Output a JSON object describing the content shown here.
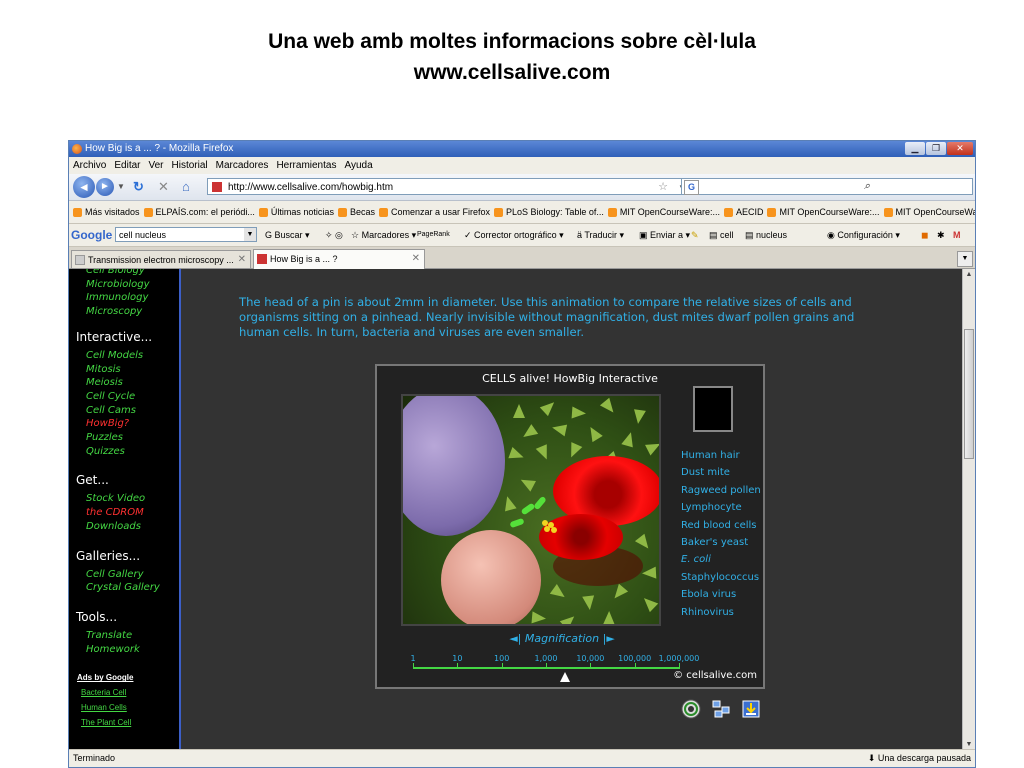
{
  "slide": {
    "title_line1": "Una web amb moltes informacions sobre cèl·lula",
    "title_line2": "www.cellsalive.com"
  },
  "browser": {
    "window_title": "How Big is a ... ? - Mozilla Firefox",
    "menu": [
      "Archivo",
      "Editar",
      "Ver",
      "Historial",
      "Marcadores",
      "Herramientas",
      "Ayuda"
    ],
    "url": "http://www.cellsalive.com/howbig.htm",
    "search_engine_letter": "G",
    "bookmarks": [
      "Más visitados",
      "ELPAÍS.com: el periódi...",
      "Últimas noticias",
      "Becas",
      "Comenzar a usar Firefox",
      "PLoS Biology: Table of...",
      "MIT OpenCourseWare:...",
      "AECID",
      "MIT OpenCourseWare:...",
      "MIT OpenCourseWare:..."
    ],
    "bookmarks_more": "»",
    "google_toolbar": {
      "logo": "Google",
      "query": "cell nucleus",
      "buscar": "Buscar",
      "marcadores": "Marcadores",
      "pagerank": "PageRank",
      "corrector": "Corrector ortográfico",
      "traducir": "Traducir",
      "enviar": "Enviar a",
      "term1": "cell",
      "term2": "nucleus",
      "configuracion": "Configuración"
    },
    "tabs": [
      {
        "label": "Transmission electron microscopy ...",
        "active": false
      },
      {
        "label": "How Big is a ... ?",
        "active": true
      }
    ],
    "status_left": "Terminado",
    "status_right": "Una descarga pausada"
  },
  "sidebar": {
    "top_links": [
      "Cell Biology",
      "Microbiology",
      "Immunology",
      "Microscopy"
    ],
    "sections": [
      {
        "title": "Interactive...",
        "links": [
          "Cell Models",
          "Mitosis",
          "Meiosis",
          "Cell Cycle",
          "Cell Cams",
          "HowBig?",
          "Puzzles",
          "Quizzes"
        ],
        "current": "HowBig?"
      },
      {
        "title": "Get...",
        "links": [
          "Stock Video",
          "the CDROM",
          "Downloads"
        ],
        "red": [
          "the CDROM"
        ]
      },
      {
        "title": "Galleries...",
        "links": [
          "Cell Gallery",
          "Crystal Gallery"
        ]
      },
      {
        "title": "Tools...",
        "links": [
          "Translate",
          "Homework"
        ]
      }
    ],
    "ads_title": "Ads by Google",
    "ads": [
      "Bacteria Cell",
      "Human Cells",
      "The Plant Cell"
    ]
  },
  "main": {
    "intro": "The head of a pin is about 2mm in diameter. Use this animation to compare the relative sizes of cells and organisms sitting on a pinhead. Nearly invisible without magnification, dust mites dwarf pollen grains and human cells. In turn, bacteria and viruses are even smaller.",
    "interactive_title": "CELLS alive! HowBig Interactive",
    "items": [
      "Human hair",
      "Dust mite",
      "Ragweed pollen",
      "Lymphocyte",
      "Red blood cells",
      "Baker's yeast",
      "E. coli",
      "Staphylococcus",
      "Ebola virus",
      "Rhinovirus"
    ],
    "magnification_label": "Magnification",
    "mag_prev": "◄|",
    "mag_next": "|►",
    "scale_labels": [
      "1",
      "10",
      "100",
      "1,000",
      "10,000",
      "100,000",
      "1,000,000"
    ],
    "scale_position": "10,000",
    "copyright": "© cellsalive.com"
  },
  "colors": {
    "link_green": "#44d744",
    "link_red": "#ff3131",
    "text_blue": "#31b0e6",
    "content_bg": "#333333"
  }
}
